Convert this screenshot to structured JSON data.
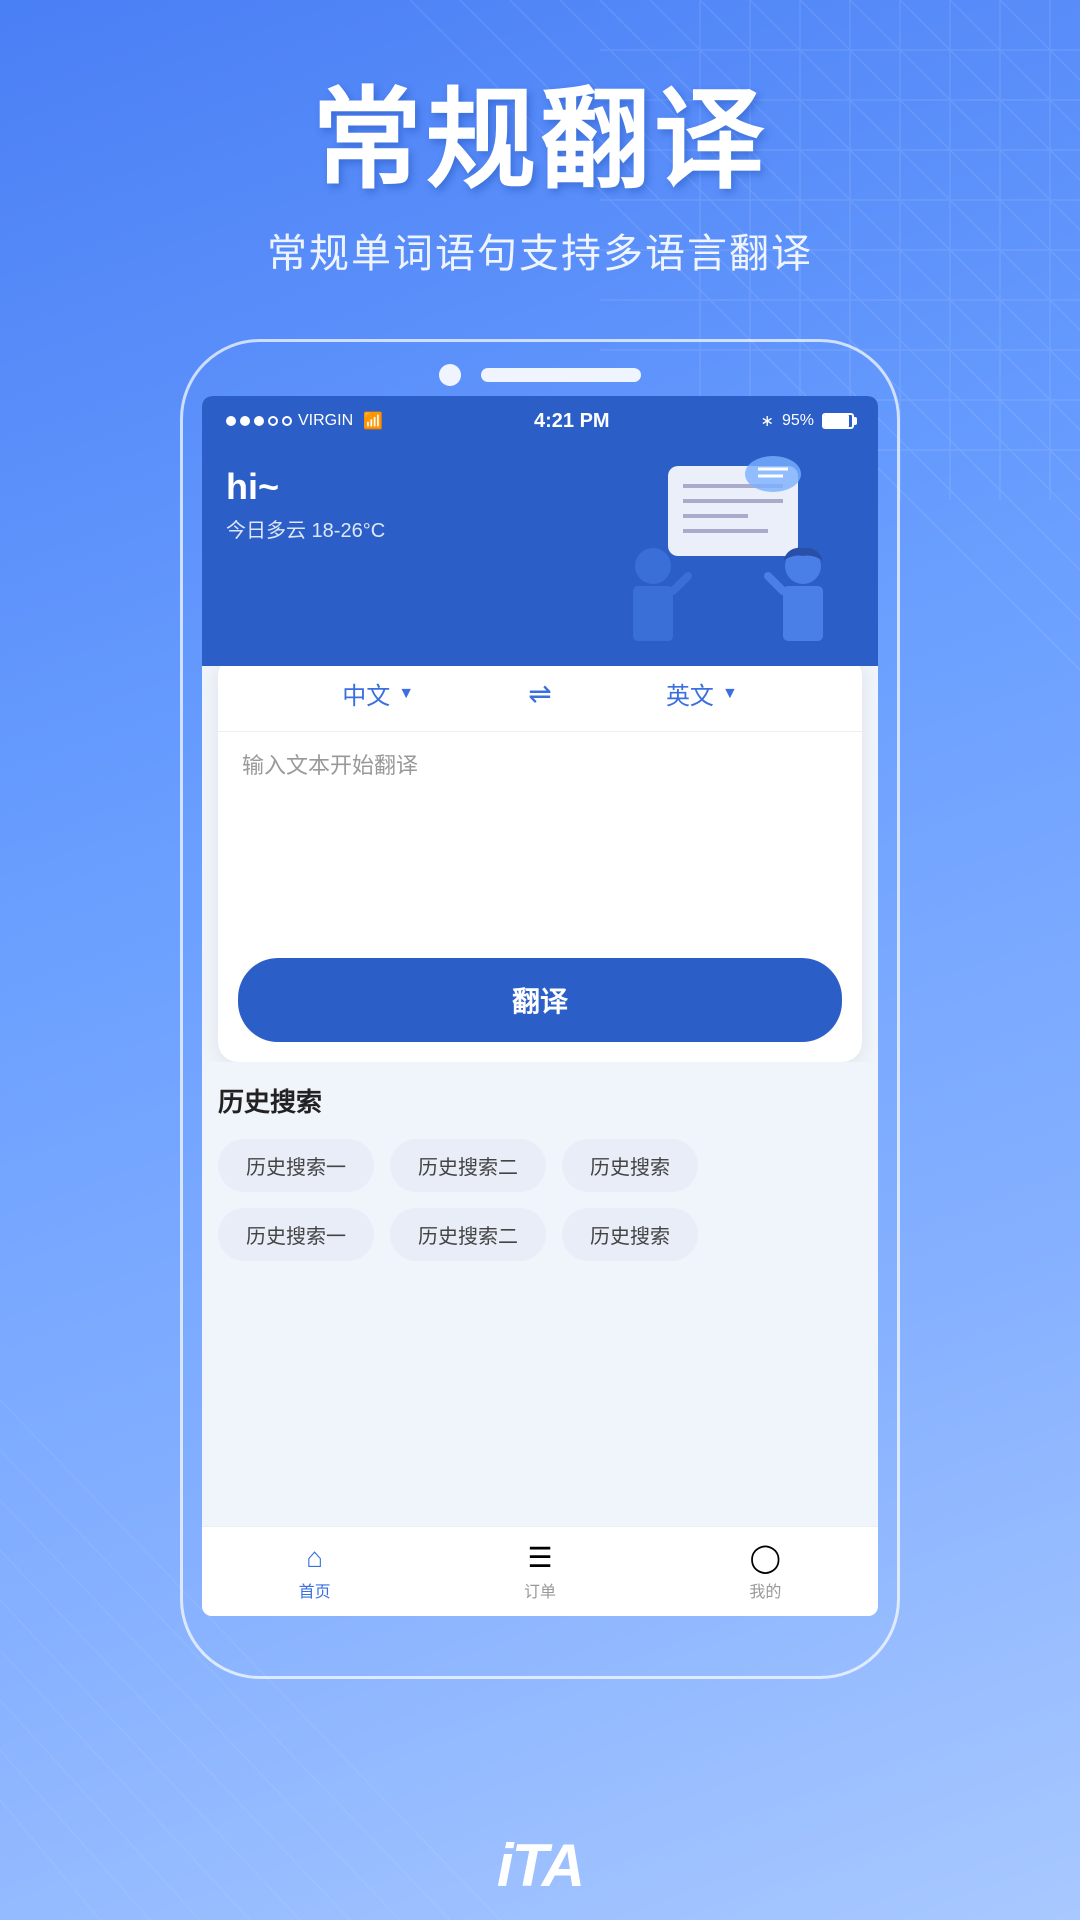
{
  "header": {
    "main_title": "常规翻译",
    "sub_title": "常规单词语句支持多语言翻译"
  },
  "status_bar": {
    "carrier": "VIRGIN",
    "time": "4:21 PM",
    "battery_percent": "95%"
  },
  "app_header": {
    "greeting": "hi~",
    "weather": "今日多云 18-26°C"
  },
  "translation": {
    "source_lang": "中文",
    "target_lang": "英文",
    "placeholder": "输入文本开始翻译",
    "translate_btn": "翻译"
  },
  "history": {
    "title": "历史搜索",
    "row1": [
      "历史搜索一",
      "历史搜索二",
      "历史搜索"
    ],
    "row2": [
      "历史搜索一",
      "历史搜索二",
      "历史搜索"
    ]
  },
  "bottom_nav": {
    "items": [
      {
        "label": "首页",
        "active": true
      },
      {
        "label": "订单",
        "active": false
      },
      {
        "label": "我的",
        "active": false
      }
    ]
  },
  "app_logo": "iTA"
}
